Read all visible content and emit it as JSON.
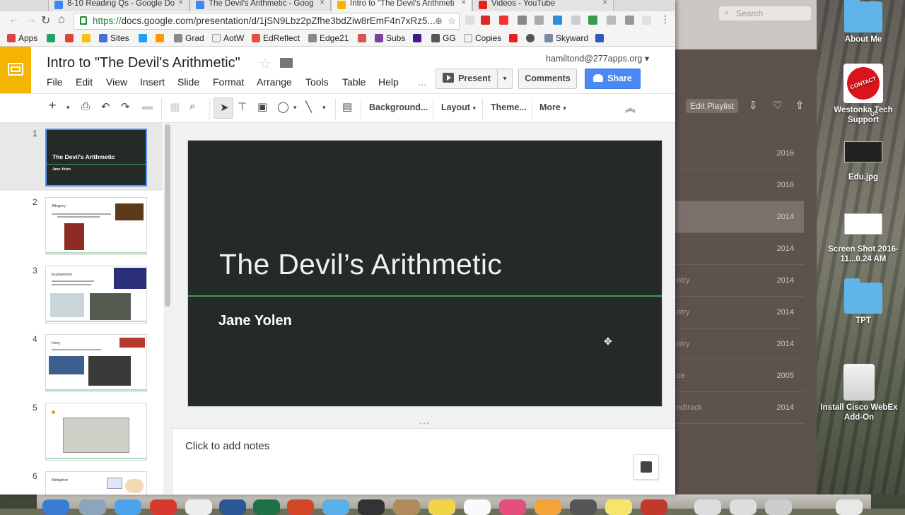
{
  "browser": {
    "tabs": [
      {
        "title": "8-10 Reading Qs - Google Do",
        "color": "#4285f4"
      },
      {
        "title": "The Devil's Arithmetic - Goog",
        "color": "#4285f4"
      },
      {
        "title": "Intro to \"The Devil's Arithmeti",
        "color": "#f4b400"
      },
      {
        "title": "Videos - YouTube",
        "color": "#e62117"
      }
    ],
    "url_scheme": "https://",
    "url_rest": "docs.google.com/presentation/d/1jSN9Lbz2pZfhe3bdZiw8rEmF4n7xRz5...",
    "bookmarks": [
      "Apps",
      "Sites",
      "Grad",
      "AotW",
      "EdReflect",
      "Edge21",
      "Subs",
      "GG",
      "Copies",
      "Skyward"
    ]
  },
  "slides": {
    "doc_title": "Intro to \"The Devil's Arithmetic\"",
    "account": "hamiltond@277apps.org",
    "menu": [
      "File",
      "Edit",
      "View",
      "Insert",
      "Slide",
      "Format",
      "Arrange",
      "Tools",
      "Table",
      "Help"
    ],
    "menu_more": "…",
    "present_label": "Present",
    "comments_label": "Comments",
    "share_label": "Share",
    "toolbar": {
      "background": "Background...",
      "layout": "Layout",
      "theme": "Theme...",
      "more": "More"
    },
    "filmstrip": [
      {
        "num": "1",
        "title": "The Devil's Arithmetic",
        "subtitle": "Jane Yolen"
      },
      {
        "num": "2",
        "title": "Allegory"
      },
      {
        "num": "3",
        "title": "Euphemism"
      },
      {
        "num": "4",
        "title": "Irony"
      },
      {
        "num": "5",
        "title": ""
      },
      {
        "num": "6",
        "title": "Metaphor"
      }
    ],
    "current_slide": {
      "title": "The Devil’s Arithmetic",
      "subtitle": "Jane Yolen"
    },
    "notes_placeholder": "Click to add notes"
  },
  "media_app": {
    "search_placeholder": "Search",
    "edit_playlist": "Edit Playlist",
    "rows": [
      {
        "text": "",
        "year": "2016"
      },
      {
        "text": "",
        "year": "2016"
      },
      {
        "text": "",
        "year": "2014"
      },
      {
        "text": "",
        "year": "2014"
      },
      {
        "text": "ntry",
        "year": "2014"
      },
      {
        "text": "ntry",
        "year": "2014"
      },
      {
        "text": "ntry",
        "year": "2014"
      },
      {
        "text": "ce",
        "year": "2005"
      },
      {
        "text": "ndtrack",
        "year": "2014"
      }
    ]
  },
  "desktop": {
    "icons": [
      "About Me",
      "Westonka Tech Support",
      "Edu.jpg",
      "Screen Shot 2016-11...0.24 AM",
      "TPT",
      "Install Cisco WebEx Add-On"
    ]
  },
  "colors": {
    "slide_bg": "#232a27",
    "accent_green": "#3f9a5e",
    "share_blue": "#4a89f3",
    "slides_yellow": "#f4b400"
  }
}
